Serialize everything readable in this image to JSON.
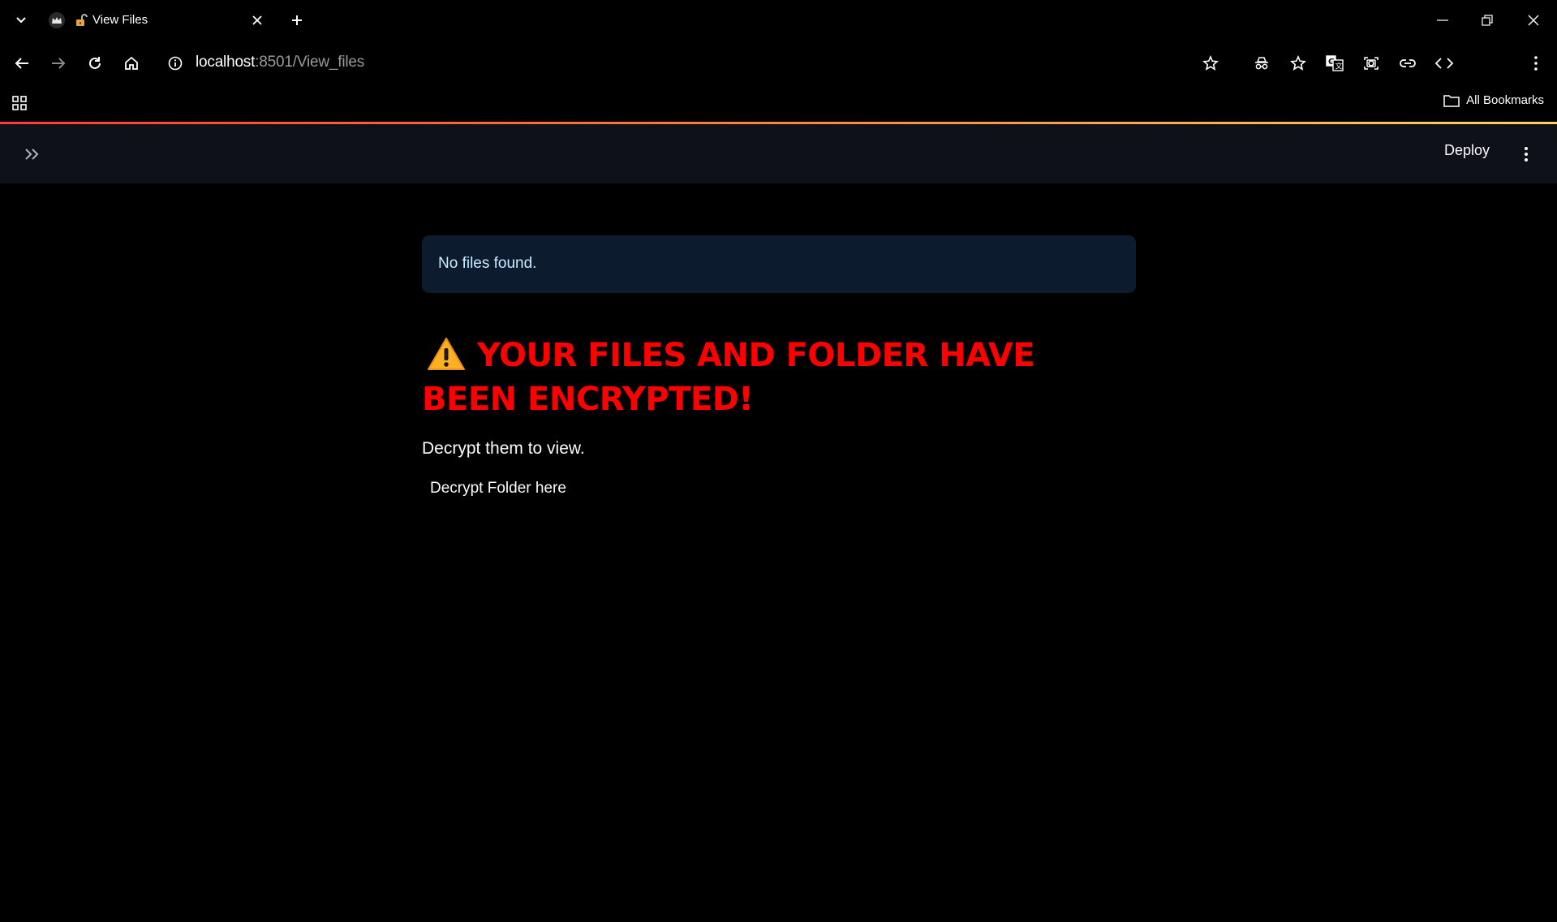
{
  "tab": {
    "title": "View Files",
    "favicon": "crown-icon"
  },
  "address_bar": {
    "host": "localhost",
    "path": ":8501/View_files"
  },
  "bookmarks": {
    "all_label": "All Bookmarks"
  },
  "app": {
    "deploy_label": "Deploy",
    "alert_text": "No files found.",
    "headline_icon": "warning-icon",
    "headline": "YOUR FILES AND FOLDER HAVE BEEN ENCRYPTED!",
    "subtext": "Decrypt them to view.",
    "link_text": "Decrypt Folder here"
  },
  "colors": {
    "header_bg": "#0e1117",
    "alert_bg": "#0c1c2e",
    "alert_text": "#c7ebff",
    "headline": "#ff0000"
  }
}
